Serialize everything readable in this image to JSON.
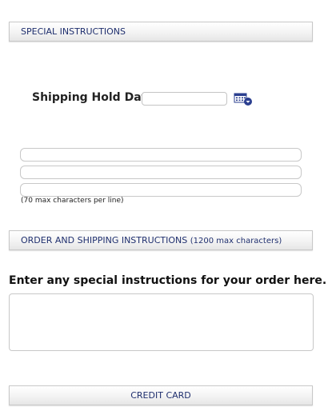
{
  "special_instructions": {
    "header": "SPECIAL INSTRUCTIONS",
    "hold_date_label": "Shipping Hold Date",
    "hold_date_value": "",
    "calendar_icon": "calendar-dropdown-icon",
    "lines": [
      "",
      "",
      ""
    ],
    "line_hint": "(70 max characters per line)"
  },
  "order_shipping": {
    "header": "ORDER AND SHIPPING INSTRUCTIONS",
    "header_note": "(1200 max characters)",
    "prompt": "Enter any special instructions for your order here.",
    "value": ""
  },
  "credit_card": {
    "header": "CREDIT CARD"
  },
  "colors": {
    "header_text": "#1f2f6e",
    "calendar_blue": "#2b3f8f"
  }
}
